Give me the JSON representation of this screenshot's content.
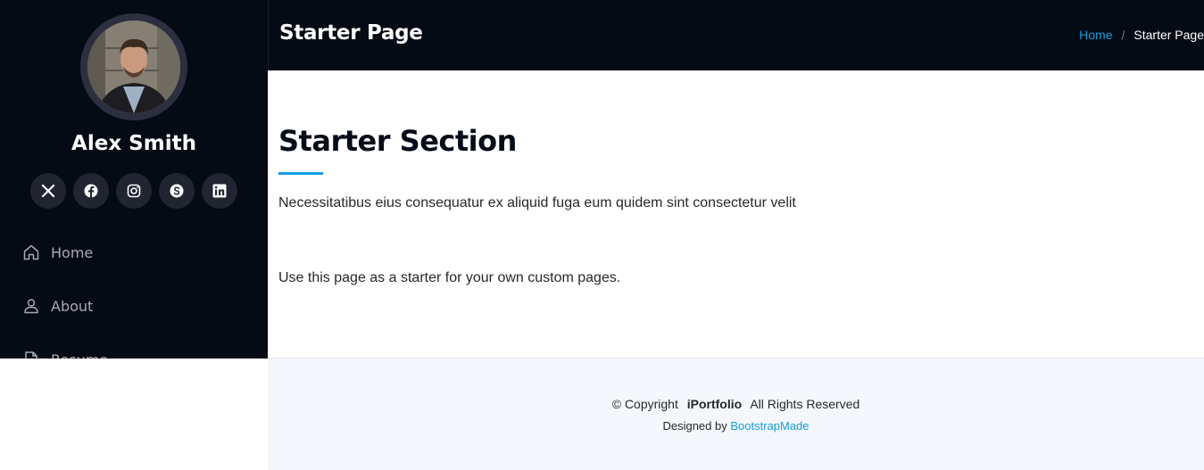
{
  "sidebar": {
    "profile_name": "Alex Smith",
    "social": [
      "x-icon",
      "facebook-icon",
      "instagram-icon",
      "skype-icon",
      "linkedin-icon"
    ],
    "nav": [
      {
        "label": "Home",
        "icon": "house-icon"
      },
      {
        "label": "About",
        "icon": "person-icon"
      },
      {
        "label": "Resume",
        "icon": "file-icon"
      }
    ]
  },
  "header": {
    "title": "Starter Page",
    "breadcrumb_home": "Home",
    "breadcrumb_sep": "/",
    "breadcrumb_current": "Starter Page"
  },
  "main": {
    "section_title": "Starter Section",
    "section_description": "Necessitatibus eius consequatur ex aliquid fuga eum quidem sint consectetur velit",
    "body_text": "Use this page as a starter for your own custom pages."
  },
  "footer": {
    "copyright_prefix": "© Copyright",
    "brand": "iPortfolio",
    "rights": "All Rights Reserved",
    "designed_by": "Designed by",
    "designer": "BootstrapMade"
  },
  "colors": {
    "sidebar_bg": "#040b14",
    "accent": "#149ddd",
    "footer_bg": "#f4f7fb"
  }
}
